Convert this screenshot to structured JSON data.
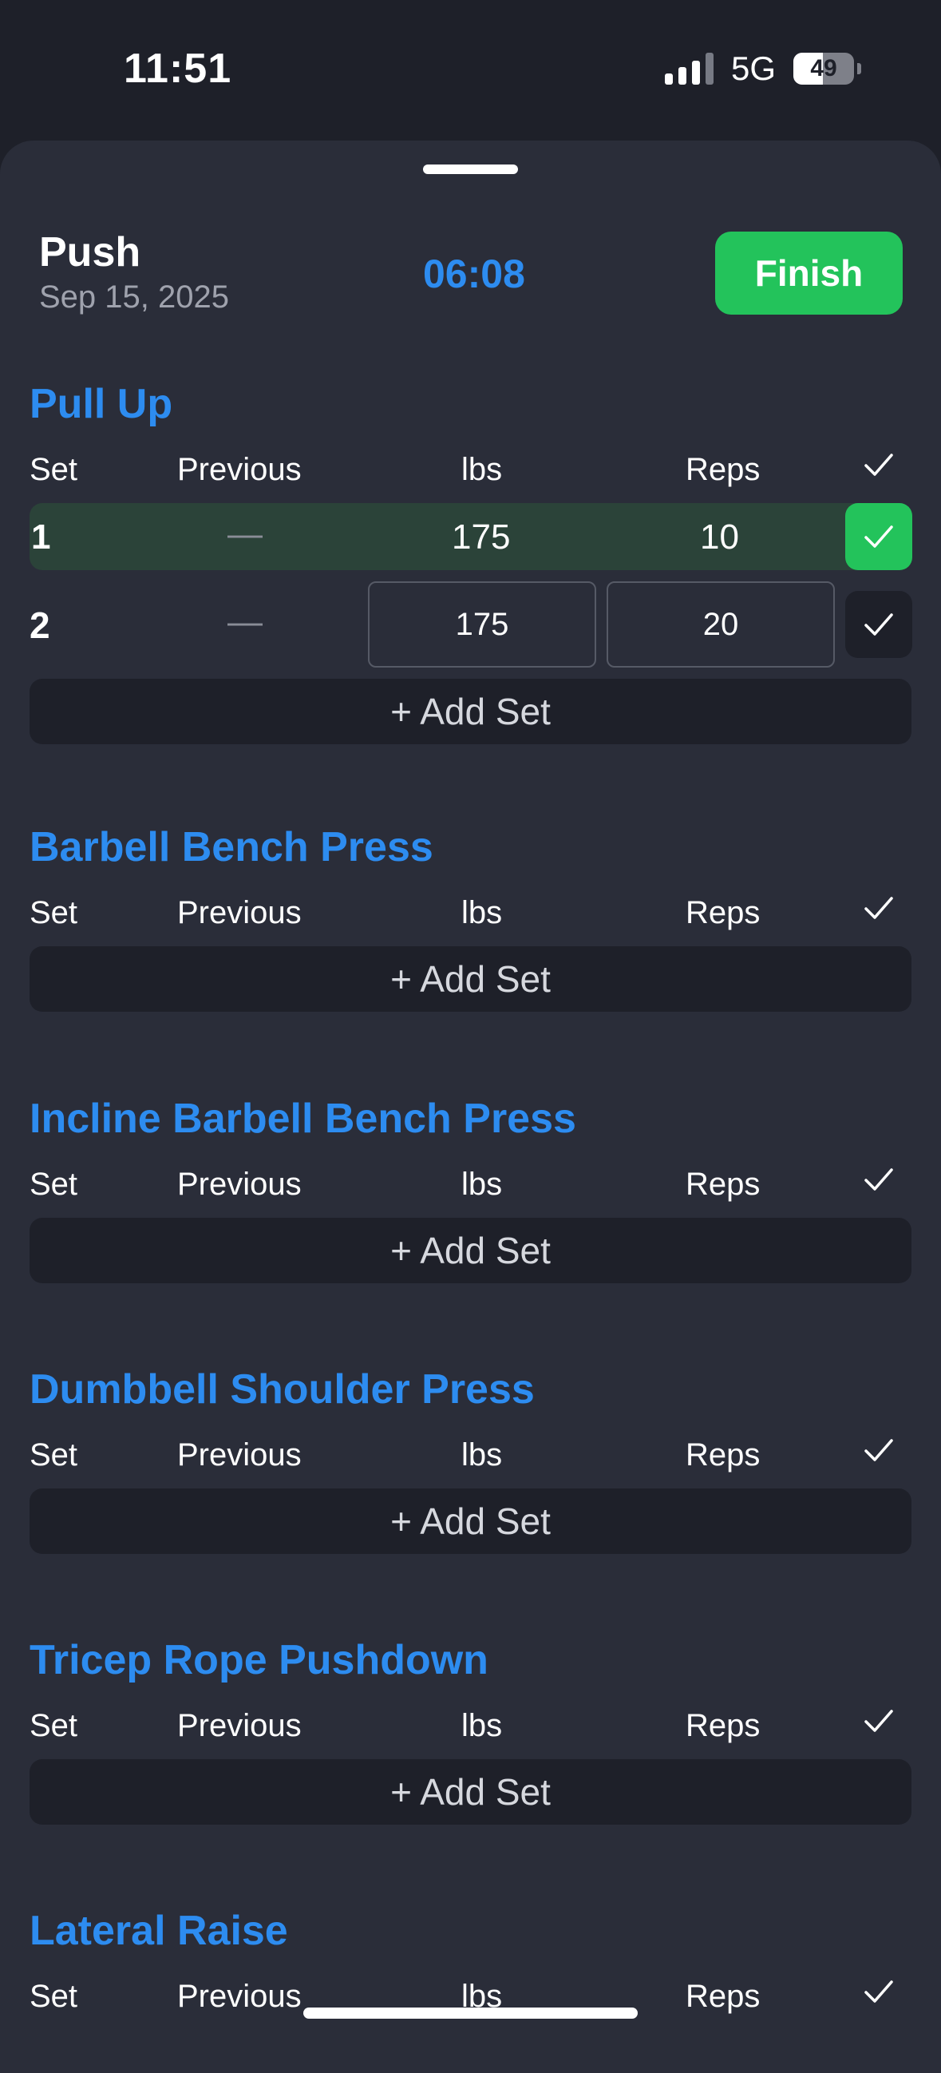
{
  "status": {
    "time": "11:51",
    "network": "5G",
    "battery": "49",
    "battery_level": 0.49
  },
  "workout": {
    "title": "Push",
    "date": "Sep 15, 2025",
    "timer": "06:08",
    "finish_label": "Finish"
  },
  "columns": {
    "set": "Set",
    "previous": "Previous",
    "weight": "lbs",
    "reps": "Reps"
  },
  "add_set_label": "+ Add Set",
  "exercises": [
    {
      "name": "Pull Up",
      "sets": [
        {
          "number": "1",
          "previous": "—",
          "weight": "175",
          "reps": "10",
          "completed": true
        },
        {
          "number": "2",
          "previous": "—",
          "weight": "175",
          "reps": "20",
          "completed": false
        }
      ]
    },
    {
      "name": "Barbell Bench Press",
      "sets": []
    },
    {
      "name": "Incline Barbell Bench Press",
      "sets": []
    },
    {
      "name": "Dumbbell Shoulder Press",
      "sets": []
    },
    {
      "name": "Tricep Rope Pushdown",
      "sets": []
    },
    {
      "name": "Lateral Raise",
      "sets": []
    }
  ],
  "colors": {
    "accent": "#2d8cf0",
    "success": "#23c35b",
    "completed_row": "#2b4339"
  }
}
